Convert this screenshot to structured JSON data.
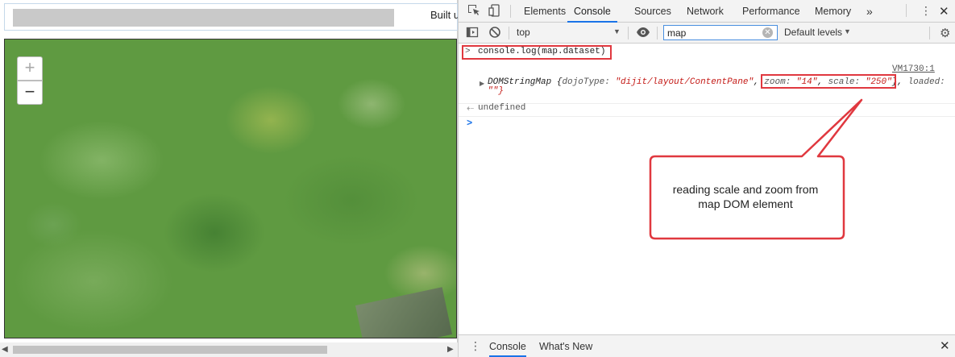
{
  "page": {
    "header_text": "Built u"
  },
  "map": {
    "zoom_in": "+",
    "zoom_out": "−"
  },
  "devtools": {
    "tabs": [
      "Elements",
      "Console",
      "Sources",
      "Network",
      "Performance",
      "Memory"
    ],
    "more_tabs": "»",
    "active_tab": "Console",
    "context": "top",
    "filter_value": "map",
    "levels": "Default levels",
    "console": {
      "command": "console.log(map.dataset)",
      "source": "VM1730:1",
      "log_prefix": "DOMStringMap ",
      "log_parts": [
        {
          "text": "{",
          "cls": "t"
        },
        {
          "text": "dojoType: ",
          "cls": "k"
        },
        {
          "text": "\"dijit/layout/ContentPane\"",
          "cls": "s"
        },
        {
          "text": ", ",
          "cls": "t"
        },
        {
          "text": "zoom: ",
          "cls": "k"
        },
        {
          "text": "\"14\"",
          "cls": "s"
        },
        {
          "text": ", ",
          "cls": "t"
        },
        {
          "text": "scale: ",
          "cls": "k"
        },
        {
          "text": "\"250\"",
          "cls": "s"
        },
        {
          "text": "}, ",
          "cls": "t"
        },
        {
          "text": "loaded:",
          "cls": "k"
        }
      ],
      "log_line2": "\"\"}",
      "return_value": "undefined"
    },
    "annotation": "reading scale and zoom from map DOM element",
    "drawer_tabs": [
      "Console",
      "What's New"
    ]
  },
  "colors": {
    "accent": "#1a73e8",
    "highlight": "#e0383f",
    "string": "#c41a16"
  }
}
